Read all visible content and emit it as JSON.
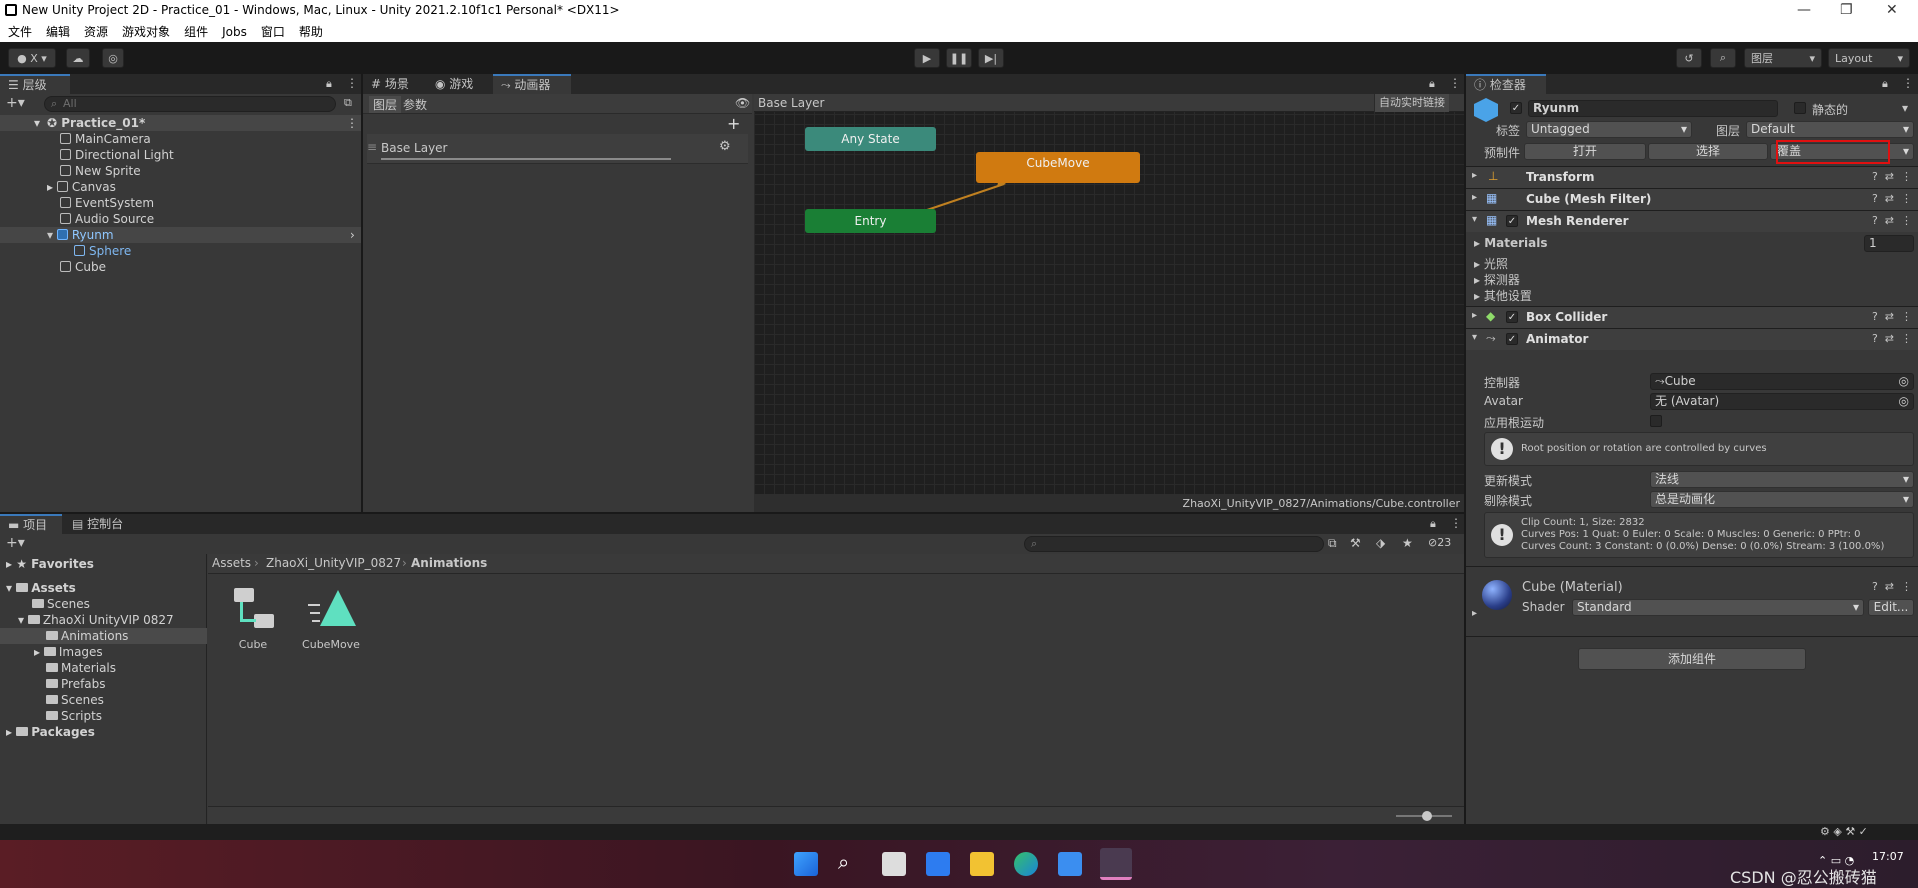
{
  "window": {
    "title": "New Unity Project 2D - Practice_01 - Windows, Mac, Linux - Unity 2021.2.10f1c1 Personal* <DX11>",
    "controls": [
      "—",
      "❐",
      "✕"
    ]
  },
  "menu": [
    "文件",
    "编辑",
    "资源",
    "游戏对象",
    "组件",
    "Jobs",
    "窗口",
    "帮助"
  ],
  "toolbar": {
    "account_label": "X",
    "layers_label": "图层",
    "layout_label": "Layout"
  },
  "hierarchy": {
    "tab": "层级",
    "search_placeholder": "All",
    "scene": "Practice_01*",
    "items": [
      {
        "label": "MainCamera"
      },
      {
        "label": "Directional Light"
      },
      {
        "label": "New Sprite"
      },
      {
        "label": "Canvas"
      },
      {
        "label": "EventSystem"
      },
      {
        "label": "Audio Source"
      },
      {
        "label": "Ryunm"
      },
      {
        "label": "Sphere"
      },
      {
        "label": "Cube"
      }
    ]
  },
  "animator": {
    "tabs": [
      "场景",
      "游戏",
      "动画器"
    ],
    "subtabs": [
      "图层",
      "参数"
    ],
    "layer_name": "Base Layer",
    "breadcrumb": "Base Layer",
    "autolive": "自动实时链接",
    "states": {
      "any": "Any State",
      "entry": "Entry",
      "cubemove": "CubeMove"
    },
    "state_colors": {
      "any": "#3b8a7b",
      "entry": "#1a7f35",
      "cubemove": "#d07a10"
    },
    "controller_path": "ZhaoXi_UnityVIP_0827/Animations/Cube.controller"
  },
  "inspector": {
    "tab": "检查器",
    "object_name": "Ryunm",
    "static_label": "静态的",
    "tag_label": "标签",
    "tag_value": "Untagged",
    "layer_label": "图层",
    "layer_value": "Default",
    "prefab_label": "预制件",
    "prefab_open": "打开",
    "prefab_select": "选择",
    "prefab_override": "覆盖",
    "components": {
      "transform": "Transform",
      "mesh_filter": "Cube (Mesh Filter)",
      "mesh_renderer": "Mesh Renderer",
      "box_collider": "Box Collider",
      "animator": "Animator"
    },
    "renderer": {
      "materials_label": "Materials",
      "materials_count": "1",
      "lighting": "光照",
      "probes": "探测器",
      "other": "其他设置"
    },
    "animator_fields": {
      "controller_label": "控制器",
      "controller_value": "Cube",
      "avatar_label": "Avatar",
      "avatar_value": "无 (Avatar)",
      "root_motion_label": "应用根运动",
      "root_help": "Root position or rotation are controlled by curves",
      "update_label": "更新模式",
      "update_value": "法线",
      "culling_label": "剔除模式",
      "culling_value": "总是动画化",
      "clip_info_1": "Clip Count: 1, Size: 2832",
      "clip_info_2": "Curves Pos: 1 Quat: 0 Euler: 0 Scale: 0 Muscles: 0 Generic: 0 PPtr: 0",
      "clip_info_3": "Curves Count: 3 Constant: 0 (0.0%) Dense: 0 (0.0%) Stream: 3 (100.0%)"
    },
    "material": {
      "name": "Cube (Material)",
      "shader_label": "Shader",
      "shader_value": "Standard",
      "edit": "Edit..."
    },
    "add_component": "添加组件"
  },
  "project": {
    "tabs": [
      "项目",
      "控制台"
    ],
    "badge": "23",
    "breadcrumb": [
      "Assets",
      "ZhaoXi_UnityVIP_0827",
      "Animations"
    ],
    "tree": {
      "favorites": "Favorites",
      "assets": "Assets",
      "items": [
        "Scenes",
        "ZhaoXi UnityVIP 0827",
        "Animations",
        "Images",
        "Materials",
        "Prefabs",
        "Scenes",
        "Scripts"
      ],
      "packages": "Packages"
    },
    "assets": [
      {
        "label": "Cube"
      },
      {
        "label": "CubeMove"
      }
    ]
  },
  "taskbar": {
    "time": "17:07",
    "watermark": "CSDN @忍公搬砖猫"
  }
}
